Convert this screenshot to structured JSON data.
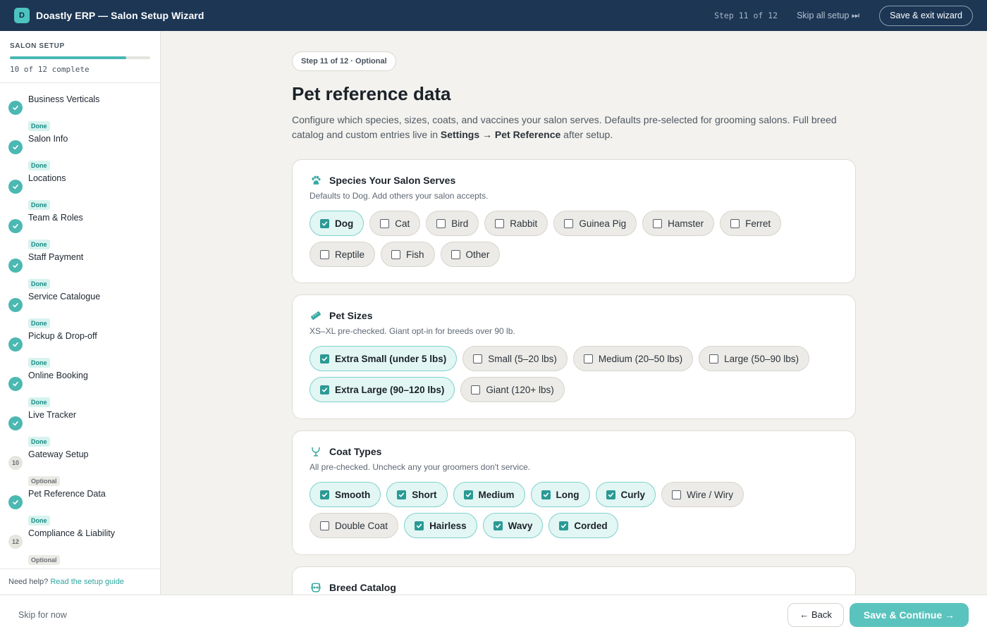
{
  "header": {
    "logo_letter": "D",
    "app_title": "Doastly ERP — Salon Setup Wizard",
    "step_indicator": "Step 11 of 12",
    "skip_all_label": "Skip all setup ⏭",
    "save_exit_label": "Save & exit wizard"
  },
  "sidebar": {
    "title": "SALON SETUP",
    "progress_text": "10 of 12 complete",
    "progress_fraction": 0.83,
    "steps": [
      {
        "label": "Business Verticals",
        "status": "Done",
        "state": "done"
      },
      {
        "label": "Salon Info",
        "status": "Done",
        "state": "done"
      },
      {
        "label": "Locations",
        "status": "Done",
        "state": "done"
      },
      {
        "label": "Team & Roles",
        "status": "Done",
        "state": "done"
      },
      {
        "label": "Staff Payment",
        "status": "Done",
        "state": "done"
      },
      {
        "label": "Service Catalogue",
        "status": "Done",
        "state": "done"
      },
      {
        "label": "Pickup & Drop-off",
        "status": "Done",
        "state": "done"
      },
      {
        "label": "Online Booking",
        "status": "Done",
        "state": "done"
      },
      {
        "label": "Live Tracker",
        "status": "Done",
        "state": "done"
      },
      {
        "label": "Gateway Setup",
        "status": "Optional",
        "state": "optional",
        "number": "10"
      },
      {
        "label": "Pet Reference Data",
        "status": "Done",
        "state": "done"
      },
      {
        "label": "Compliance & Liability",
        "status": "Optional",
        "state": "optional",
        "number": "12"
      }
    ],
    "help_text": "Need help?",
    "help_link": "Read the setup guide"
  },
  "main": {
    "step_pill": "Step 11 of 12 · Optional",
    "title": "Pet reference data",
    "subtitle_part1": "Configure which species, sizes, coats, and vaccines your salon serves. Defaults pre-selected for grooming salons. Full breed catalog and custom entries live in ",
    "subtitle_bold": "Settings → Pet Reference",
    "subtitle_part2": " after setup.",
    "sections": {
      "species": {
        "title": "Species Your Salon Serves",
        "desc": "Defaults to Dog. Add others your salon accepts.",
        "icon": "paw-icon",
        "options": [
          {
            "label": "Dog",
            "checked": true
          },
          {
            "label": "Cat",
            "checked": false
          },
          {
            "label": "Bird",
            "checked": false
          },
          {
            "label": "Rabbit",
            "checked": false
          },
          {
            "label": "Guinea Pig",
            "checked": false
          },
          {
            "label": "Hamster",
            "checked": false
          },
          {
            "label": "Ferret",
            "checked": false
          },
          {
            "label": "Reptile",
            "checked": false
          },
          {
            "label": "Fish",
            "checked": false
          },
          {
            "label": "Other",
            "checked": false
          }
        ]
      },
      "sizes": {
        "title": "Pet Sizes",
        "desc": "XS–XL pre-checked. Giant opt-in for breeds over 90 lb.",
        "icon": "ruler-icon",
        "options": [
          {
            "label": "Extra Small (under 5 lbs)",
            "checked": true
          },
          {
            "label": "Small (5–20 lbs)",
            "checked": false
          },
          {
            "label": "Medium (20–50 lbs)",
            "checked": false
          },
          {
            "label": "Large (50–90 lbs)",
            "checked": false
          },
          {
            "label": "Extra Large (90–120 lbs)",
            "checked": true
          },
          {
            "label": "Giant (120+ lbs)",
            "checked": false
          }
        ]
      },
      "coats": {
        "title": "Coat Types",
        "desc": "All pre-checked. Uncheck any your groomers don't service.",
        "icon": "coat-icon",
        "options": [
          {
            "label": "Smooth",
            "checked": true
          },
          {
            "label": "Short",
            "checked": true
          },
          {
            "label": "Medium",
            "checked": true
          },
          {
            "label": "Long",
            "checked": true
          },
          {
            "label": "Curly",
            "checked": true
          },
          {
            "label": "Wire / Wiry",
            "checked": false
          },
          {
            "label": "Double Coat",
            "checked": false
          },
          {
            "label": "Hairless",
            "checked": true
          },
          {
            "label": "Wavy",
            "checked": true
          },
          {
            "label": "Corded",
            "checked": true
          }
        ]
      },
      "breeds": {
        "title": "Breed Catalog",
        "icon": "dog-face-icon"
      }
    }
  },
  "footer": {
    "skip_label": "Skip for now",
    "back_label": "← Back",
    "continue_label": "Save & Continue →"
  },
  "colors": {
    "header_bg": "#1c3654",
    "accent_teal": "#4cb8b2",
    "chip_selected_bg": "#e2f6f4",
    "page_bg": "#f3f2ee"
  }
}
